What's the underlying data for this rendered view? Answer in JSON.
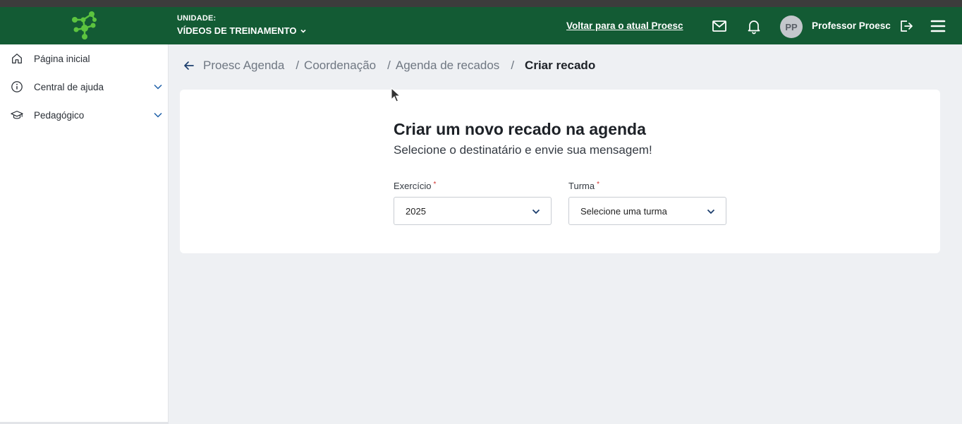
{
  "header": {
    "unit_label": "UNIDADE:",
    "unit_name": "VÍDEOS DE TREINAMENTO",
    "back_link": "Voltar para o atual Proesc",
    "avatar_initials": "PP",
    "user_name": "Professor Proesc",
    "bg_color": "#135b34"
  },
  "sidebar": {
    "items": [
      {
        "label": "Página inicial",
        "icon": "home-icon"
      },
      {
        "label": "Central de ajuda",
        "icon": "info-icon"
      },
      {
        "label": "Pedagógico",
        "icon": "graduation-cap-icon"
      }
    ]
  },
  "breadcrumb": {
    "items": [
      "Proesc Agenda",
      "Coordenação",
      "Agenda de recados"
    ],
    "separator": "/",
    "current": "Criar recado"
  },
  "form": {
    "title": "Criar um novo recado na agenda",
    "subtitle": "Selecione o destinatário e envie sua mensagem!",
    "exercicio": {
      "label": "Exercício",
      "required_mark": "*",
      "value": "2025"
    },
    "turma": {
      "label": "Turma",
      "required_mark": "*",
      "value": "Selecione uma turma"
    }
  }
}
